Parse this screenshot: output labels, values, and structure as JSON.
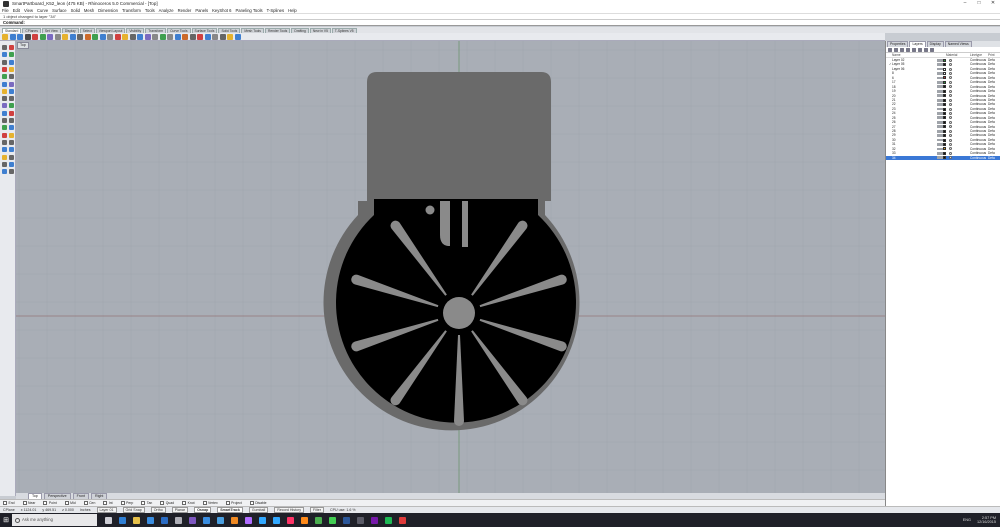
{
  "window": {
    "title": "SmartPartboard_K52_leon (475 KB) - Rhinoceros 5.0 Commercial - [Top]",
    "minimize": "–",
    "maximize": "□",
    "close": "✕"
  },
  "menu": [
    "File",
    "Edit",
    "View",
    "Curve",
    "Surface",
    "Solid",
    "Mesh",
    "Dimension",
    "Transform",
    "Tools",
    "Analyze",
    "Render",
    "Panels",
    "KeyShot 6",
    "Paneling Tools",
    "T-Splines",
    "Help"
  ],
  "command": {
    "history": "1 object changed to layer \"34\"",
    "prompt": "Command:"
  },
  "toolbar_tabs": [
    "Standard",
    "CPlanes",
    "Set View",
    "Display",
    "Select",
    "Viewport Layout",
    "Visibility",
    "Transform",
    "Curve Tools",
    "Surface Tools",
    "Solid Tools",
    "Mesh Tools",
    "Render Tools",
    "Drafting",
    "New in V5",
    "T-Splines V5"
  ],
  "toolbar_active_tab": "Standard",
  "viewport": {
    "label": "Top",
    "background": "#a9aeb6",
    "part_colors": {
      "body": "#6a6a6a",
      "insert": "#000000",
      "spokes": "#8a8a8a"
    }
  },
  "view_tabs": [
    "Perspective",
    "Front",
    "Right"
  ],
  "osnaps": [
    "End",
    "Near",
    "Point",
    "Mid",
    "Cen",
    "Int",
    "Perp",
    "Tan",
    "Quad",
    "Knot",
    "Vertex",
    "Project",
    "Disable"
  ],
  "status": {
    "cplane": "CPlane",
    "x": "x 1124.01",
    "y": "y 469.51",
    "z": "z 0.000",
    "units": "Inches",
    "layer": "Layer 01",
    "buttons": [
      "Grid Snap",
      "Ortho",
      "Planar",
      "Osnap",
      "SmartTrack",
      "Gumball",
      "Record History",
      "Filter"
    ],
    "active_buttons": [
      "Osnap",
      "SmartTrack"
    ],
    "info": "CPU use: 1.6 %"
  },
  "panel": {
    "tabs": [
      "Properties",
      "Layers",
      "Display",
      "Named Views"
    ],
    "active_tab": "Layers",
    "columns": [
      "Name",
      "Material",
      "Linetype",
      "Print"
    ],
    "layers": [
      {
        "name": "Layer 02",
        "color": "#2a9d3a",
        "linetype": "Continuous",
        "print": "Defa"
      },
      {
        "name": "Layer 05",
        "color": "#111111",
        "linetype": "Continuous",
        "print": "Defa",
        "current": true
      },
      {
        "name": "Layer 06",
        "color": "#ffffff",
        "linetype": "Continuous",
        "print": "Defa"
      },
      {
        "name": "8",
        "color": "#ffffff",
        "linetype": "Continuous",
        "print": "Defa"
      },
      {
        "name": "6",
        "color": "#c23a3a",
        "linetype": "Continuous",
        "print": "Defa"
      },
      {
        "name": "17",
        "color": "#2a9d3a",
        "linetype": "Continuous",
        "print": "Defa"
      },
      {
        "name": "18",
        "color": "#111111",
        "linetype": "Continuous",
        "print": "Defa"
      },
      {
        "name": "19",
        "color": "#111111",
        "linetype": "Continuous",
        "print": "Defa"
      },
      {
        "name": "20",
        "color": "#111111",
        "linetype": "Continuous",
        "print": "Defa"
      },
      {
        "name": "21",
        "color": "#111111",
        "linetype": "Continuous",
        "print": "Defa"
      },
      {
        "name": "22",
        "color": "#111111",
        "linetype": "Continuous",
        "print": "Defa"
      },
      {
        "name": "23",
        "color": "#111111",
        "linetype": "Continuous",
        "print": "Defa"
      },
      {
        "name": "24",
        "color": "#111111",
        "linetype": "Continuous",
        "print": "Defa"
      },
      {
        "name": "25",
        "color": "#111111",
        "linetype": "Continuous",
        "print": "Defa"
      },
      {
        "name": "26",
        "color": "#111111",
        "linetype": "Continuous",
        "print": "Defa"
      },
      {
        "name": "27",
        "color": "#111111",
        "linetype": "Continuous",
        "print": "Defa"
      },
      {
        "name": "28",
        "color": "#111111",
        "linetype": "Continuous",
        "print": "Defa"
      },
      {
        "name": "29",
        "color": "#111111",
        "linetype": "Continuous",
        "print": "Defa"
      },
      {
        "name": "30",
        "color": "#111111",
        "linetype": "Continuous",
        "print": "Defa"
      },
      {
        "name": "31",
        "color": "#111111",
        "linetype": "Continuous",
        "print": "Defa"
      },
      {
        "name": "32",
        "color": "#d9a12a",
        "linetype": "Continuous",
        "print": "Defa"
      },
      {
        "name": "33",
        "color": "#111111",
        "linetype": "Continuous",
        "print": "Defa"
      },
      {
        "name": "34",
        "color": "#111111",
        "linetype": "Continuous",
        "print": "Defa",
        "selected": true
      }
    ]
  },
  "taskbar": {
    "search_placeholder": "Ask me anything",
    "apps": [
      "task-view",
      "edge",
      "explorer",
      "store",
      "mail",
      "rhino",
      "visual-studio",
      "photos",
      "calendar",
      "illustrator",
      "premiere",
      "photoshop",
      "lightroom",
      "indesign",
      "firefox",
      "chrome",
      "qt",
      "word",
      "calculator",
      "onenote",
      "spotify",
      "app-red"
    ],
    "app_colors": [
      "#cfcfd6",
      "#2f7fd4",
      "#e6c04a",
      "#3a8de0",
      "#2b6cc4",
      "#b0b0b8",
      "#7d56c0",
      "#3a8de0",
      "#4a9fe0",
      "#f08a24",
      "#b06cff",
      "#31a8ff",
      "#31a8ff",
      "#ff3366",
      "#ff8a1a",
      "#4caf50",
      "#41cd52",
      "#2b579a",
      "#5a5a66",
      "#7719aa",
      "#1db954",
      "#e03a3a"
    ],
    "time": "2:57 PM",
    "date": "12/16/2015",
    "lang": "ENG"
  }
}
